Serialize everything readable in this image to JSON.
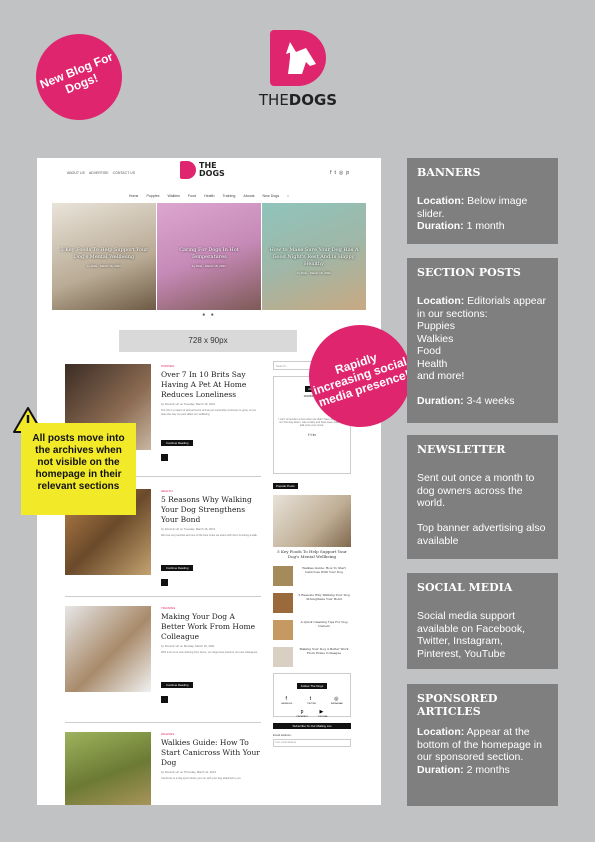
{
  "badge": "New Blog For Dogs!",
  "brand": {
    "part1": "THE",
    "part2": "DOGS"
  },
  "site": {
    "toplinks": [
      "ABOUT US",
      "ADVERTISE",
      "CONTACT US"
    ],
    "logo_line1": "THE",
    "logo_line2": "DOGS",
    "nav": [
      "Home",
      "Puppies",
      "Walkies",
      "Food",
      "Health",
      "Training",
      "Abouts",
      "New Dogs"
    ],
    "slides": [
      {
        "title": "5 Key Foods To Help Support Your Dog's Mental Wellbeing",
        "meta": "by Ditto · March 18, 2021"
      },
      {
        "title": "Caring For Dogs In Hot Temperatures",
        "meta": "by Ditto · March 18, 2021"
      },
      {
        "title": "How to Make Sure Your Dog Has A Good Night's Rest And Is Happy, Healthy",
        "meta": "by Ditto · March 18, 2021"
      }
    ],
    "ad_label": "728 x 90px",
    "posts": [
      {
        "cat": "PUPPIES",
        "title": "Over 7 In 10 Brits Say Having A Pet At Home Reduces Loneliness",
        "meta": "by Dominic Uri on Tuesday, March 16, 2021",
        "excerpt": "The UK is a nation of animal lovers and as pet ownership continues to grow, so too does the way our pets affect our wellbeing.",
        "btn": "Continue Reading"
      },
      {
        "cat": "HEALTH",
        "title": "5 Reasons Why Walking Your Dog Strengthens Your Bond",
        "meta": "by Dominic Uri on Tuesday, March 16, 2021",
        "excerpt": "We love our pooches and one of the best times we share with them is during a walk.",
        "btn": "Continue Reading"
      },
      {
        "cat": "TRAINING",
        "title": "Making Your Dog A Better Work From Home Colleague",
        "meta": "by Dominic Uri on Monday, March 15, 2021",
        "excerpt": "With a lot of us now working from home, our dogs have become our new colleagues.",
        "btn": "Continue Reading"
      },
      {
        "cat": "WALKIES",
        "title": "Walkies Guide: How To Start Canicross With Your Dog",
        "meta": "by Dominic Uri on Thursday, March 11, 2021",
        "excerpt": "Canicross is a dog sport where you run with your dog attached to you."
      }
    ],
    "sidebar": {
      "search_placeholder": "Search ...",
      "about_title": "About",
      "about_heading": "DOMINIC URI",
      "about_text": "I can't remember a time when we didn't have dogs. We got our first dog when I was a baby and have been looking to add more ever since.",
      "popular_title": "Popular Posts",
      "popular_main": "5 Key Foods To Help Support Your Dog's Mental Wellbeing",
      "popular_list": [
        "Walkies Guide: How To Start Canicross With Your Dog",
        "5 Reasons Why Walking Your Dog Strengthens Your Bond",
        "A Quick Cleaning Tips For Dog Owners",
        "Making Your Dog A Better Work From Home Colleague"
      ],
      "follow_title": "Follow The Dogs",
      "follow_icons": [
        "FACEBOOK",
        "TWITTER",
        "INSTAGRAM",
        "PINTEREST",
        "YOUTUBE"
      ],
      "mailing_title": "Subscribe To Our Mailing List",
      "email_label": "Email address:",
      "email_placeholder": "Your email address"
    }
  },
  "stamp": "Rapidly increasing social media presence!",
  "note": "All posts move into the archives when not visible on the homepage in their relevant sections",
  "boxes": [
    {
      "title": "BANNERS",
      "lines": [
        [
          "Location:",
          " Below image slider."
        ],
        [
          "Duration:",
          " 1 month"
        ]
      ]
    },
    {
      "title": "SECTION POSTS",
      "lines": [
        [
          "Location:",
          " Editorials appear in our sections:"
        ],
        [
          "",
          "Puppies"
        ],
        [
          "",
          "Walkies"
        ],
        [
          "",
          "Food"
        ],
        [
          "",
          "Health"
        ],
        [
          "",
          "and more!"
        ],
        [
          "",
          " "
        ],
        [
          "Duration:",
          " 3-4 weeks"
        ]
      ]
    },
    {
      "title": "NEWSLETTER",
      "lines": [
        [
          "",
          "Sent out once a month to dog owners across the world."
        ],
        [
          "",
          " "
        ],
        [
          "",
          "Top banner advertising also available"
        ]
      ]
    },
    {
      "title": "SOCIAL MEDIA",
      "lines": [
        [
          "",
          "Social media support available on Facebook, Twitter, Instagram, Pinterest, YouTube"
        ]
      ]
    },
    {
      "title": "SPONSORED ARTICLES",
      "lines": [
        [
          "Location:",
          " Appear at the bottom of the homepage in our sponsored section."
        ],
        [
          "Duration:",
          " 2 months"
        ]
      ]
    }
  ]
}
